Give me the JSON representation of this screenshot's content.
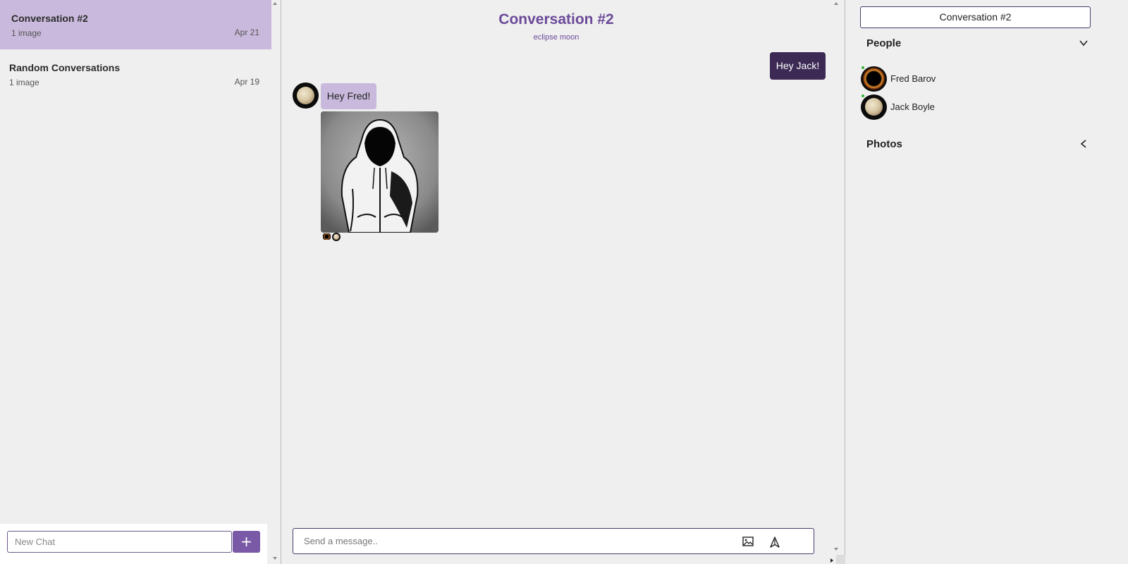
{
  "sidebar": {
    "conversations": [
      {
        "title": "Conversation #2",
        "subtitle": "1 image",
        "date": "Apr 21",
        "active": true
      },
      {
        "title": "Random Conversations",
        "subtitle": "1 image",
        "date": "Apr 19",
        "active": false
      }
    ],
    "new_chat_placeholder": "New Chat",
    "new_chat_button": "+"
  },
  "chat": {
    "title": "Conversation #2",
    "subtitle": "eclipse moon",
    "messages": [
      {
        "direction": "outgoing",
        "text": "Hey Jack!"
      },
      {
        "direction": "incoming",
        "text": "Hey Fred!"
      }
    ],
    "composer_placeholder": "Send a message..",
    "icons": {
      "attach": "image-attach-icon",
      "send": "send-icon"
    }
  },
  "details": {
    "title": "Conversation #2",
    "people_heading": "People",
    "people": [
      {
        "name": "Fred Barov",
        "online": true,
        "avatar": "eclipse"
      },
      {
        "name": "Jack Boyle",
        "online": true,
        "avatar": "moon"
      }
    ],
    "photos_heading": "Photos"
  },
  "colors": {
    "accent": "#7a5aa6",
    "title_purple": "#6b4a99",
    "active_item": "#c9b9dc",
    "outgoing_bubble": "#3c2a55",
    "online": "#3ab33a"
  }
}
